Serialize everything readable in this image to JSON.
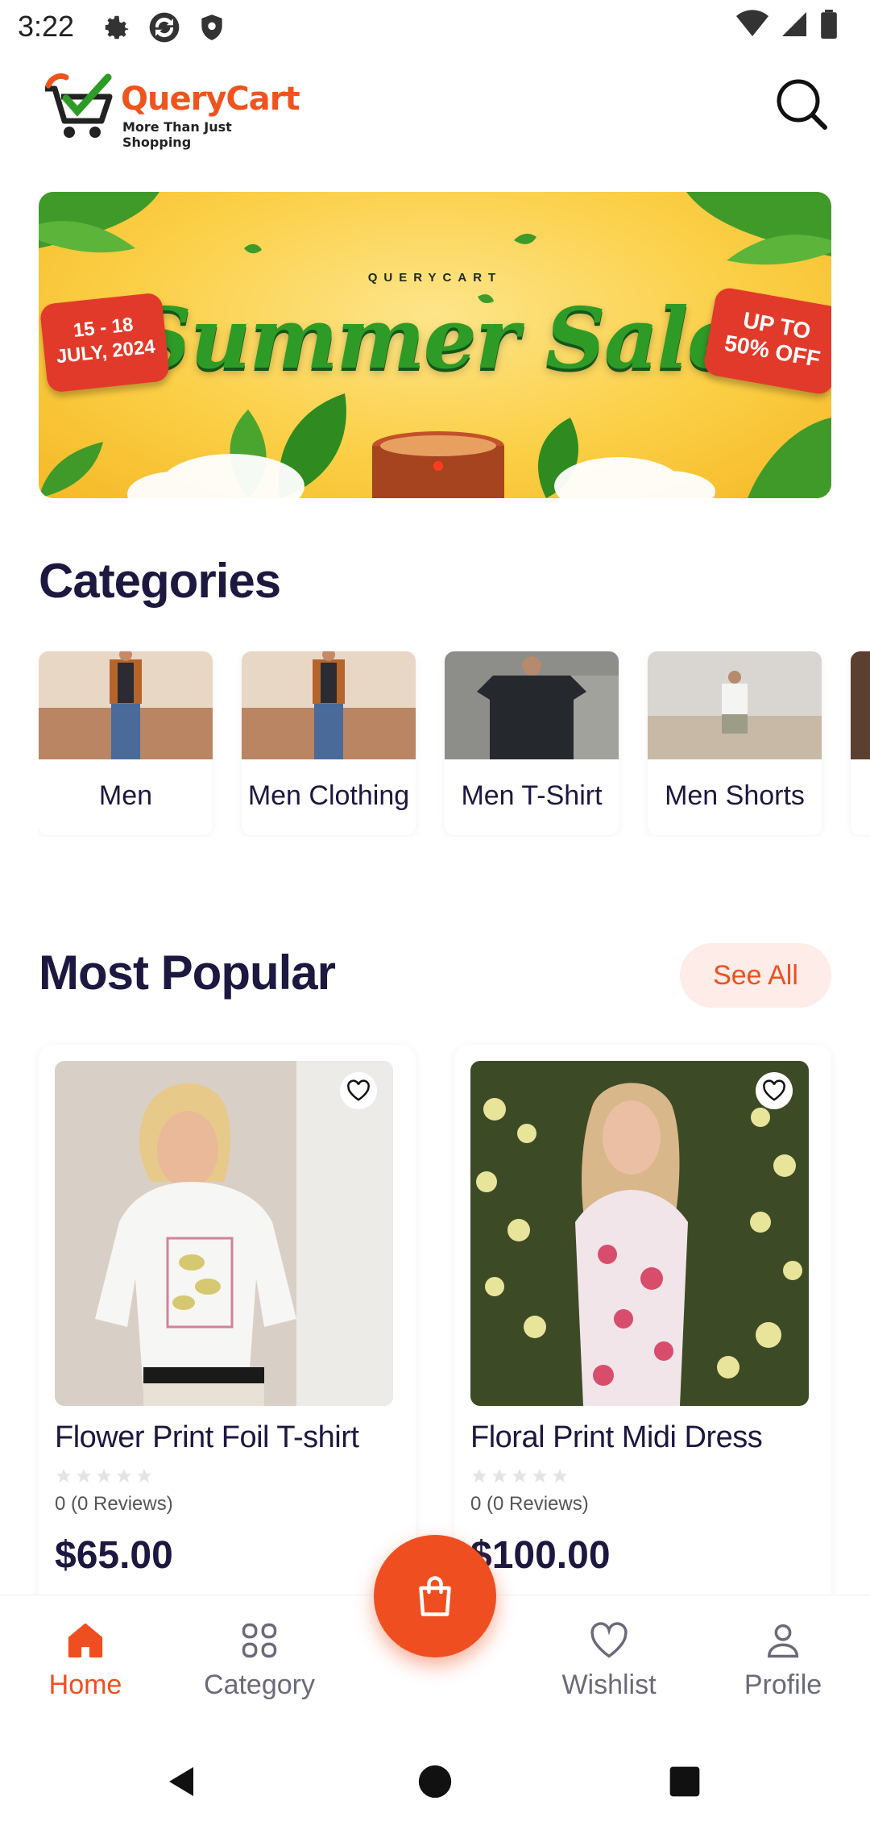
{
  "status_bar": {
    "time": "3:22"
  },
  "header": {
    "brand": "QueryCart",
    "tagline": "More Than Just Shopping"
  },
  "banner": {
    "brand": "QUERYCART",
    "title": "Summer Sale",
    "date_line1": "15 - 18",
    "date_line2": "JULY, 2024",
    "offer_line1": "UP TO",
    "offer_line2": "50% OFF"
  },
  "categories": {
    "title": "Categories",
    "items": [
      {
        "label": "Men"
      },
      {
        "label": "Men Clothing"
      },
      {
        "label": "Men T-Shirt"
      },
      {
        "label": "Men Shorts"
      }
    ]
  },
  "popular": {
    "title": "Most Popular",
    "see_all": "See All",
    "products": [
      {
        "name": "Flower Print Foil T-shirt",
        "rating": 0,
        "reviews": "0 (0  Reviews)",
        "price": "$65.00"
      },
      {
        "name": "Floral Print Midi Dress",
        "rating": 0,
        "reviews": "0 (0  Reviews)",
        "price": "$100.00"
      }
    ]
  },
  "bottom_nav": {
    "items": [
      {
        "label": "Home",
        "icon": "home-icon",
        "active": true
      },
      {
        "label": "Category",
        "icon": "grid-icon",
        "active": false
      },
      {
        "label": "Wishlist",
        "icon": "heart-icon",
        "active": false
      },
      {
        "label": "Profile",
        "icon": "user-icon",
        "active": false
      }
    ],
    "fab_icon": "shopping-bag-icon"
  },
  "colors": {
    "accent": "#ef4f20",
    "heading": "#1c1840",
    "banner_bg": "#fbcf46",
    "banner_title": "#2e9b26"
  }
}
